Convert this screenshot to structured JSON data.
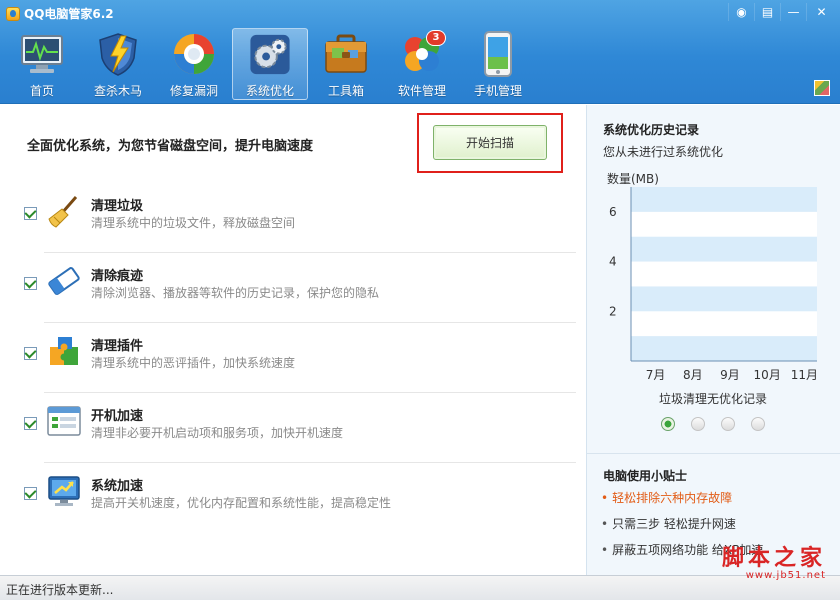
{
  "window": {
    "title": "QQ电脑管家6.2",
    "controls": {
      "feedback": "◉",
      "menu": "▤",
      "minimize": "—",
      "close": "✕"
    }
  },
  "toolbar": {
    "items": [
      {
        "label": "首页",
        "icon": "monitor-pulse-icon"
      },
      {
        "label": "查杀木马",
        "icon": "shield-lightning-icon"
      },
      {
        "label": "修复漏洞",
        "icon": "repair-ring-icon"
      },
      {
        "label": "系统优化",
        "icon": "gears-icon",
        "active": true
      },
      {
        "label": "工具箱",
        "icon": "toolbox-icon"
      },
      {
        "label": "软件管理",
        "icon": "software-flower-icon",
        "badge": "3"
      },
      {
        "label": "手机管理",
        "icon": "phone-icon"
      }
    ]
  },
  "main": {
    "title": "全面优化系统，为您节省磁盘空间，提升电脑速度",
    "scan_button": "开始扫描",
    "items": [
      {
        "name": "清理垃圾",
        "desc": "清理系统中的垃圾文件，释放磁盘空间",
        "checked": true,
        "icon": "broom-icon"
      },
      {
        "name": "清除痕迹",
        "desc": "清除浏览器、播放器等软件的历史记录，保护您的隐私",
        "checked": true,
        "icon": "eraser-icon"
      },
      {
        "name": "清理插件",
        "desc": "清理系统中的恶评插件，加快系统速度",
        "checked": true,
        "icon": "puzzle-icon"
      },
      {
        "name": "开机加速",
        "desc": "清理非必要开机启动项和服务项，加快开机速度",
        "checked": true,
        "icon": "startup-window-icon"
      },
      {
        "name": "系统加速",
        "desc": "提高开关机速度，优化内存配置和系统性能，提高稳定性",
        "checked": true,
        "icon": "speed-monitor-icon"
      }
    ]
  },
  "side": {
    "history_title": "系统优化历史记录",
    "history_sub": "您从未进行过系统优化",
    "chart_caption": "垃圾清理无优化记录",
    "carousel_active": 0,
    "tips_title": "电脑使用小贴士",
    "tips": [
      {
        "text": "轻松排除六种内存故障",
        "highlight": true
      },
      {
        "text": "只需三步 轻松提升网速",
        "highlight": false
      },
      {
        "text": "屏蔽五项网络功能 给XP加速",
        "highlight": false
      }
    ]
  },
  "chart_data": {
    "type": "bar",
    "ylabel": "数量(MB)",
    "categories": [
      "7月",
      "8月",
      "9月",
      "10月",
      "11月"
    ],
    "yticks": [
      2,
      4,
      6
    ],
    "ylim": [
      0,
      7
    ],
    "values": [
      0,
      0,
      0,
      0,
      0
    ],
    "grid": true
  },
  "status": {
    "text": "正在进行版本更新..."
  },
  "watermark": {
    "line1": "脚本之家",
    "line2": "www.jb51.net"
  },
  "colors": {
    "header": "#2f88d6",
    "accent_red": "#e0201b",
    "tip_highlight": "#e25c16"
  }
}
